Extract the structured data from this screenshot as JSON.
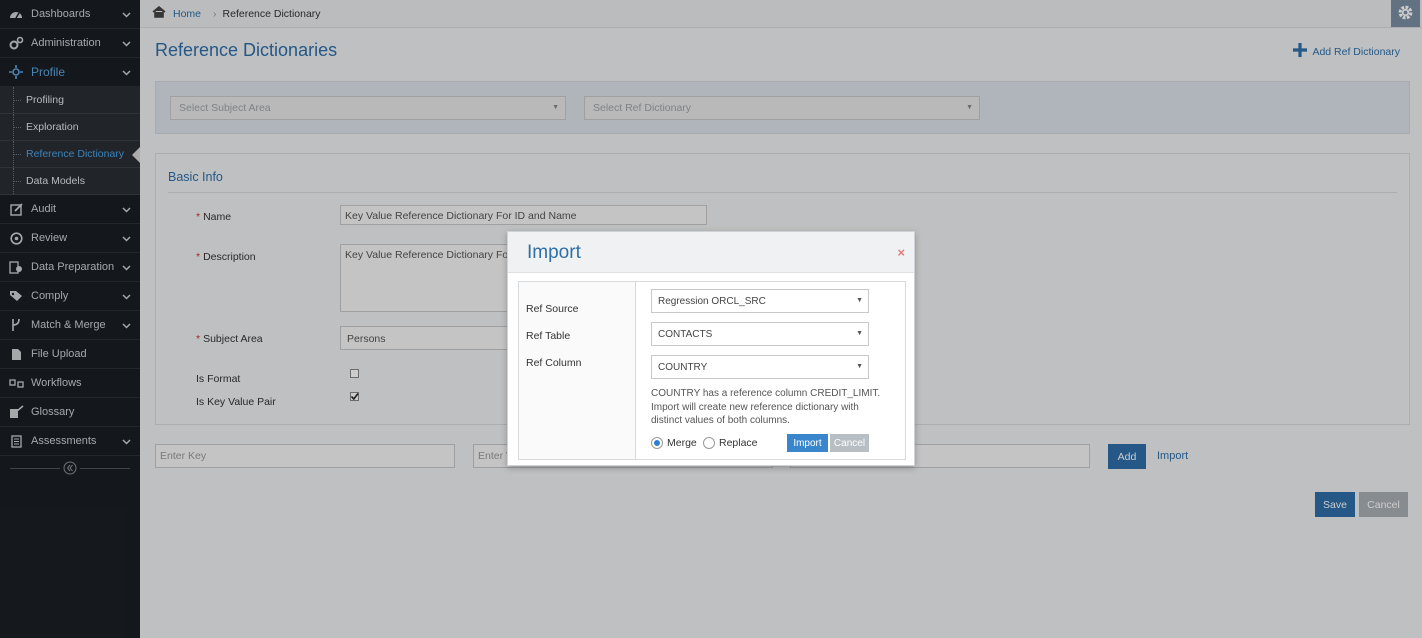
{
  "sidebar": {
    "items": [
      {
        "label": "Dashboards",
        "icon": "dashboard-icon"
      },
      {
        "label": "Administration",
        "icon": "cogs-icon"
      },
      {
        "label": "Profile",
        "icon": "profile-icon"
      },
      {
        "label": "Audit",
        "icon": "edit-icon"
      },
      {
        "label": "Review",
        "icon": "review-icon"
      },
      {
        "label": "Data Preparation",
        "icon": "data-prep-icon"
      },
      {
        "label": "Comply",
        "icon": "tags-icon"
      },
      {
        "label": "Match & Merge",
        "icon": "merge-icon"
      },
      {
        "label": "File Upload",
        "icon": "file-icon"
      },
      {
        "label": "Workflows",
        "icon": "workflow-icon"
      },
      {
        "label": "Glossary",
        "icon": "glossary-icon"
      },
      {
        "label": "Assessments",
        "icon": "assessment-icon"
      }
    ],
    "profile_sub": [
      "Profiling",
      "Exploration",
      "Reference Dictionary",
      "Data Models"
    ]
  },
  "breadcrumb": {
    "home": "Home",
    "current": "Reference Dictionary"
  },
  "page": {
    "title": "Reference Dictionaries",
    "add_label": "Add Ref Dictionary",
    "subject_area_placeholder": "Select Subject Area",
    "ref_dictionary_placeholder": "Select Ref Dictionary"
  },
  "basic_info": {
    "title": "Basic Info",
    "name_label": "Name",
    "name_value": "Key Value Reference Dictionary For ID and Name",
    "description_label": "Description",
    "description_value": "Key Value Reference Dictionary For",
    "subject_area_label": "Subject Area",
    "subject_area_value": "Persons",
    "is_format_label": "Is Format",
    "is_key_value_label": "Is Key Value Pair"
  },
  "kv": {
    "key_placeholder": "Enter Key",
    "value_placeholder": "Enter V",
    "add_label": "Add",
    "import_label": "Import",
    "save_label": "Save",
    "cancel_label": "Cancel"
  },
  "modal": {
    "title": "Import",
    "close": "×",
    "ref_source_label": "Ref Source",
    "ref_table_label": "Ref Table",
    "ref_column_label": "Ref Column",
    "ref_source_value": "Regression ORCL_SRC",
    "ref_table_value": "CONTACTS",
    "ref_column_value": "COUNTRY",
    "note": "COUNTRY has a reference column CREDIT_LIMIT. Import will create new reference dictionary with distinct values of both columns.",
    "merge_label": "Merge",
    "replace_label": "Replace",
    "import_label": "Import",
    "cancel_label": "Cancel"
  },
  "colors": {
    "accent": "#2f6fa8",
    "sidebar_bg": "#1a1f24",
    "active_sub": "#4aa3e6"
  }
}
